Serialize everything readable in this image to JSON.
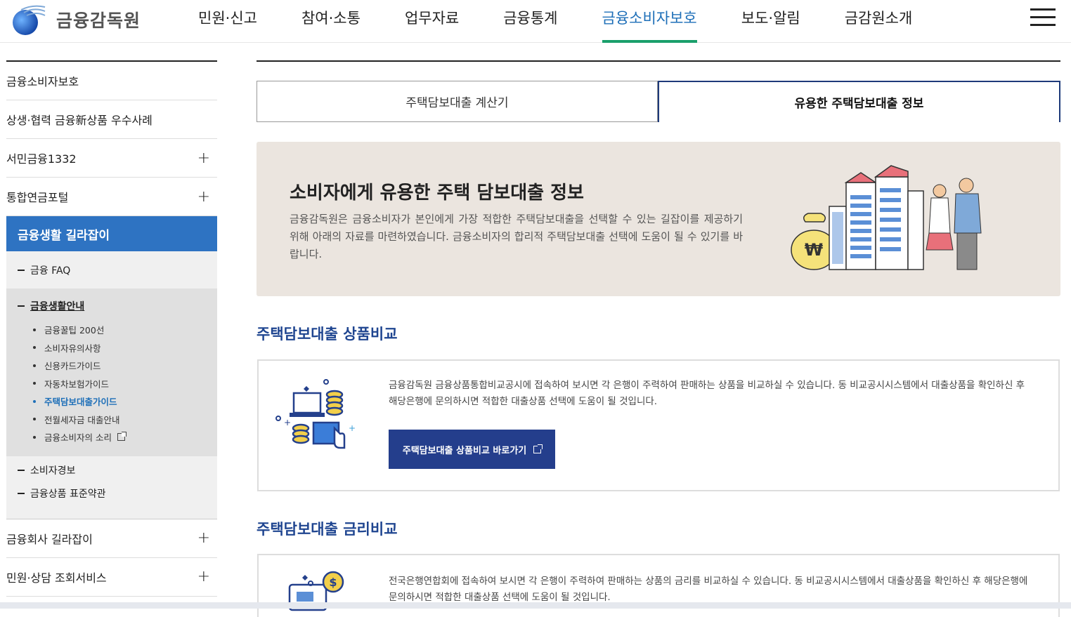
{
  "header": {
    "logo_text": "금융감독원",
    "nav": [
      "민원·신고",
      "참여·소통",
      "업무자료",
      "금융통계",
      "금융소비자보호",
      "보도·알림",
      "금감원소개"
    ],
    "active_nav": "금융소비자보호"
  },
  "sidebar": {
    "items": [
      {
        "label": "금융소비자보호"
      },
      {
        "label": "상생·협력 금융新상품 우수사례"
      },
      {
        "label": "서민금융1332",
        "expand": "+"
      },
      {
        "label": "통합연금포털",
        "expand": "+"
      }
    ],
    "active": "금융생활 길라잡이",
    "sub": {
      "faq": "금융 FAQ",
      "guide": "금융생활안내",
      "guide_items": [
        "금융꿀팁 200선",
        "소비자유의사항",
        "신용카드가이드",
        "자동차보험가이드",
        "주택담보대출가이드",
        "전월세자금 대출안내",
        "금융소비자의 소리"
      ],
      "warning": "소비자경보",
      "terms": "금융상품 표준약관"
    },
    "bottom_items": [
      {
        "label": "금융회사 길라잡이",
        "expand": "+"
      },
      {
        "label": "민원·상담 조회서비스",
        "expand": "+"
      }
    ]
  },
  "tabs": {
    "calc": "주택담보대출 계산기",
    "info": "유용한 주택담보대출 정보"
  },
  "banner": {
    "title": "소비자에게 유용한 주택 담보대출 정보",
    "desc": "금융감독원은 금융소비자가 본인에게 가장 적합한 주택담보대출을 선택할 수 있는 길잡이를 제공하기 위해 아래의 자료를 마련하였습니다. 금융소비자의 합리적 주택담보대출 선택에 도움이 될 수 있기를 바랍니다."
  },
  "section1": {
    "title": "주택담보대출 상품비교",
    "desc": "금융감독원 금융상품통합비교공시에 접속하여 보시면 각 은행이 주력하여 판매하는 상품을 비교하실 수 있습니다. 동 비교공시시스템에서 대출상품을 확인하신 후 해당은행에 문의하시면 적합한 대출상품 선택에 도움이 될 것입니다.",
    "button": "주택담보대출 상품비교 바로가기"
  },
  "section2": {
    "title": "주택담보대출 금리비교",
    "desc": "전국은행연합회에 접속하여 보시면 각 은행이 주력하여 판매하는 상품의 금리를 비교하실 수 있습니다. 동 비교공시시스템에서 대출상품을 확인하신 후 해당은행에 문의하시면 적합한 대출상품 선택에 도움이 될 것입니다."
  },
  "colors": {
    "primary": "#2e73c2",
    "navy": "#243e8c",
    "active_nav": "#1e6fb8",
    "accent_green": "#1a9f6b",
    "banner_bg": "#ebe5df"
  },
  "icons": [
    "logo-globe-icon",
    "hamburger-menu-icon",
    "plus-icon",
    "external-link-icon",
    "money-bag-icon",
    "computer-coins-icon"
  ]
}
